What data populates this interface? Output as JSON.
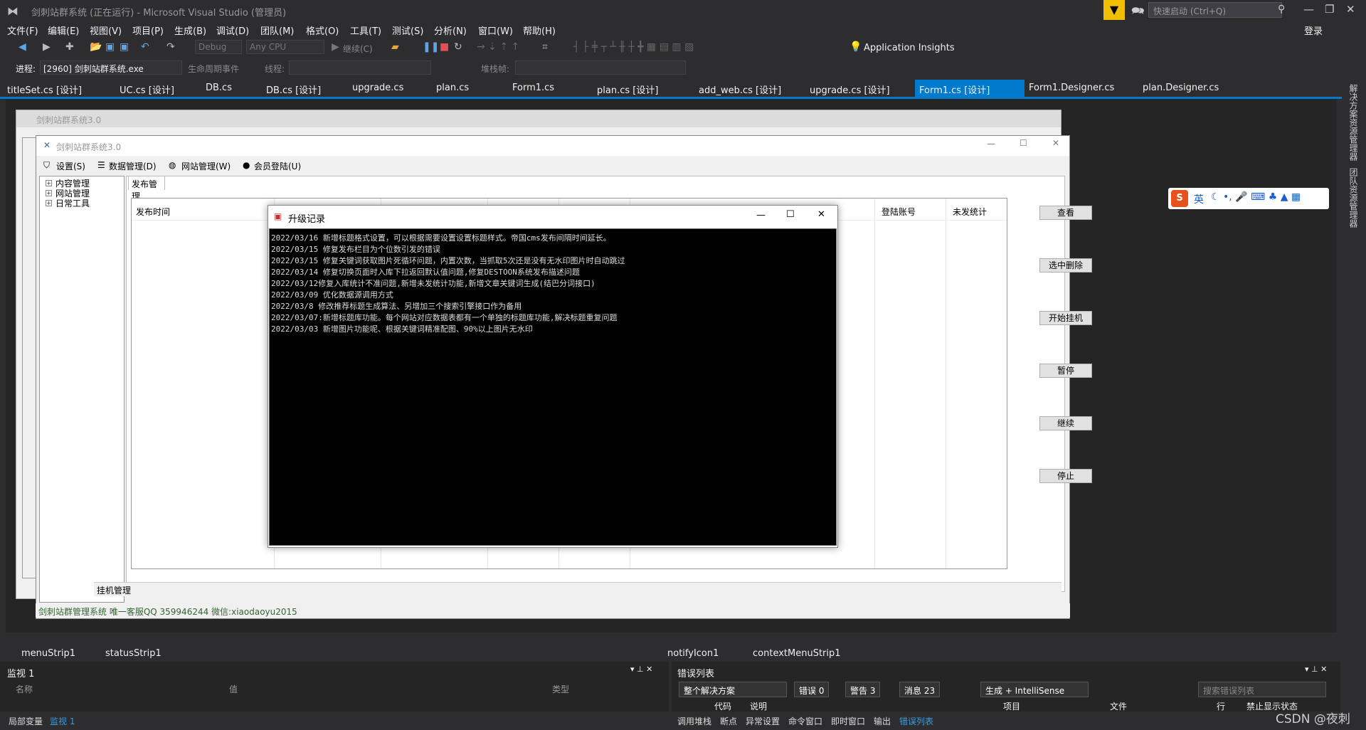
{
  "app": {
    "title": "剑刺站群系统 (正在运行) - Microsoft Visual Studio (管理员)",
    "quick_launch_placeholder": "快速启动 (Ctrl+Q)",
    "login": "登录"
  },
  "menu": [
    "文件(F)",
    "编辑(E)",
    "视图(V)",
    "项目(P)",
    "生成(B)",
    "调试(D)",
    "团队(M)",
    "格式(O)",
    "工具(T)",
    "测试(S)",
    "分析(N)",
    "窗口(W)",
    "帮助(H)"
  ],
  "toolbar": {
    "config": "Debug",
    "platform": "Any CPU",
    "continue": "继续(C)",
    "app_insights": "Application Insights",
    "process_label": "进程:",
    "process_value": "[2960] 剑刺站群系统.exe",
    "lifecycle": "生命周期事件",
    "thread_label": "线程:",
    "stackframe_label": "堆栈帧:"
  },
  "doc_tabs": [
    "titleSet.cs [设计]",
    "UC.cs [设计]",
    "DB.cs",
    "DB.cs [设计]",
    "upgrade.cs",
    "plan.cs",
    "Form1.cs",
    "plan.cs [设计]",
    "add_web.cs [设计]",
    "upgrade.cs [设计]",
    "Form1.cs [设计]",
    "Form1.Designer.cs",
    "plan.Designer.cs"
  ],
  "right_rail": [
    "解决方案资源管理器",
    "团队资源管理器"
  ],
  "outer_form_title": "剑刺站群系统3.0",
  "inner_form": {
    "title": "剑刺站群系统3.0",
    "menu": [
      "设置(S)",
      "数据管理(D)",
      "网站管理(W)",
      "会员登陆(U)"
    ],
    "tree": [
      "内容管理",
      "网站管理",
      "日常工具"
    ],
    "tab": "发布管理",
    "columns": [
      "发布时间",
      "登陆账号",
      "未发统计"
    ],
    "buttons": [
      "查看",
      "选中删除",
      "开始挂机",
      "暂停",
      "继续",
      "停止"
    ],
    "hang_tab": "挂机管理",
    "status": "剑刺站群管理系统 唯一客服QQ 359946244 微信:xiaodaoyu2015"
  },
  "popup": {
    "title": "升级记录",
    "lines": [
      "2022/03/16 新增标题格式设置，可以根据需要设置设置标题样式。帝国cms发布间隔时间延长。",
      "2022/03/15 修复发布栏目为个位数引发的错误",
      "2022/03/15 修复关键词获取图片死循环问题，内置次数，当抓取5次还是没有无水印图片时自动跳过",
      "2022/03/14 修复切换页面时入库下拉返回默认值问题,修复DESTOON系统发布描述问题",
      "2022/03/12修复入库统计不准问题,新增未发统计功能,新增文章关键词生成(结巴分词接口)",
      "2022/03/09 优化数据源调用方式",
      " 2022/03/8 修改推荐标题生成算法、另增加三个搜索引擎接口作为备用",
      "2022/03/07:新增标题库功能。每个网站对应数据表都有一个单独的标题库功能,解决标题重复问题",
      "2022/03/03 新增图片功能呢、根据关键词精准配图、90%以上图片无水印"
    ]
  },
  "tray": [
    "menuStrip1",
    "statusStrip1",
    "notifyIcon1",
    "contextMenuStrip1"
  ],
  "watch": {
    "title": "监视 1",
    "col_name": "名称",
    "col_value": "值",
    "col_type": "类型"
  },
  "errors": {
    "title": "错误列表",
    "scope": "整个解决方案",
    "errors": "错误 0",
    "warnings": "警告 3",
    "messages": "消息 23",
    "build": "生成 + IntelliSense",
    "search_placeholder": "搜索错误列表",
    "cols": [
      "代码",
      "说明",
      "项目",
      "文件",
      "行",
      "禁止显示状态"
    ]
  },
  "bottom_tabs_left": [
    "局部变量",
    "监视 1"
  ],
  "bottom_tabs_right": [
    "调用堆栈",
    "断点",
    "异常设置",
    "命令窗口",
    "即时窗口",
    "输出",
    "错误列表"
  ],
  "ime": "英",
  "watermark": "CSDN @夜刺",
  "colors": {
    "accent": "#007acc",
    "vs_bg": "#2d2d30",
    "filter": "#f0c000"
  }
}
